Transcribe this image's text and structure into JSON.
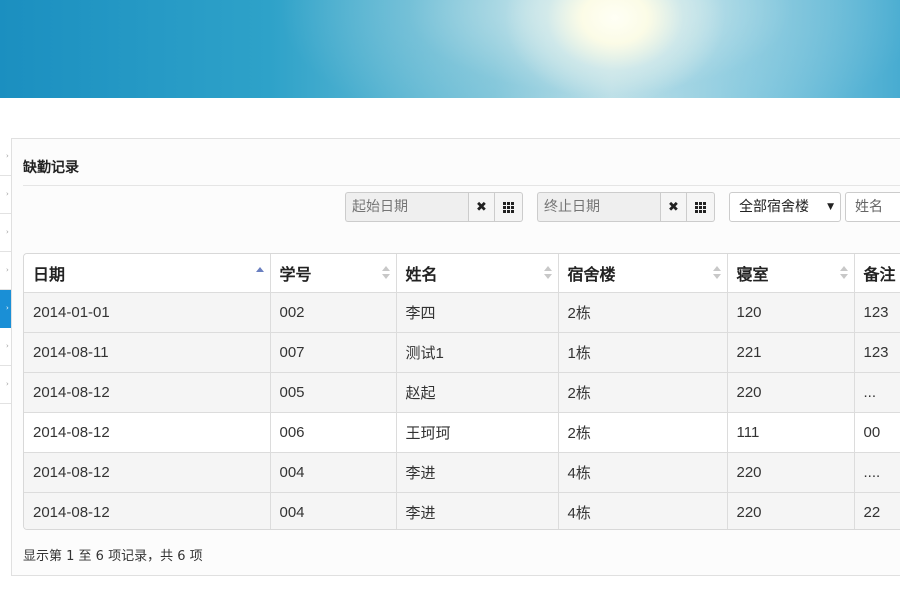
{
  "panel": {
    "title": "缺勤记录"
  },
  "filters": {
    "start_date": {
      "placeholder": "起始日期",
      "clear_icon": "times-icon",
      "calendar_icon": "th-icon"
    },
    "end_date": {
      "placeholder": "终止日期",
      "clear_icon": "times-icon",
      "calendar_icon": "th-icon"
    },
    "building_select": {
      "value": "全部宿舍楼",
      "caret": "▼"
    },
    "name_input": {
      "placeholder": "姓名"
    }
  },
  "table": {
    "headers": [
      "日期",
      "学号",
      "姓名",
      "宿舍楼",
      "寝室",
      "备注"
    ],
    "sorted_column": "日期",
    "sort_direction": "asc",
    "rows": [
      [
        "2014-01-01",
        "002",
        "李四",
        "2栋",
        "120",
        "123"
      ],
      [
        "2014-08-11",
        "007",
        "测试1",
        "1栋",
        "221",
        "123"
      ],
      [
        "2014-08-12",
        "005",
        "赵起",
        "2栋",
        "220",
        "..."
      ],
      [
        "2014-08-12",
        "006",
        "王珂珂",
        "2栋",
        "111",
        "00"
      ],
      [
        "2014-08-12",
        "004",
        "李进",
        "4栋",
        "220",
        "...."
      ],
      [
        "2014-08-12",
        "004",
        "李进",
        "4栋",
        "220",
        "22"
      ]
    ]
  },
  "footer": {
    "info": "显示第 1 至 6 项记录，共 6 项"
  },
  "colors": {
    "accent": "#1a8fd6",
    "sort_active": "#6a7fc0"
  }
}
